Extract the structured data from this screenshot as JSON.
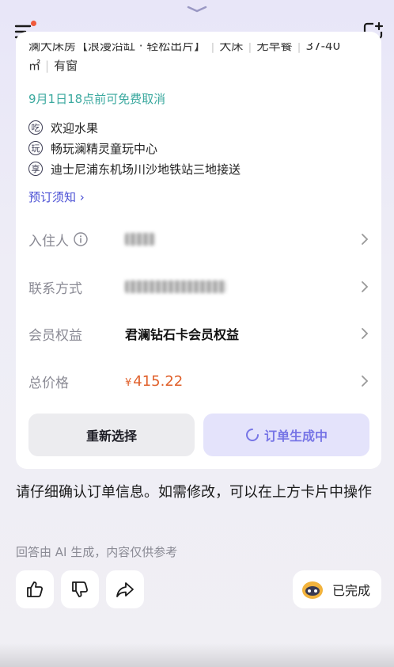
{
  "room": {
    "line1": [
      "澜大床房【浪漫沿缸 · 轻松出片】",
      "大床",
      "无早餐",
      "37-40"
    ],
    "line2_area": "㎡",
    "line2_window": "有窗"
  },
  "cancel_policy": "9月1日18点前可免费取消",
  "perks": [
    {
      "tag": "吃",
      "text": "欢迎水果"
    },
    {
      "tag": "玩",
      "text": "畅玩澜精灵童玩中心"
    },
    {
      "tag": "享",
      "text": "迪士尼浦东机场川沙地铁站三地接送"
    }
  ],
  "booking_notice": "预订须知 ›",
  "fields": {
    "guest_label": "入住人",
    "contact_label": "联系方式",
    "member_label": "会员权益",
    "member_value": "君澜钻石卡会员权益",
    "total_label": "总价格",
    "currency": "¥",
    "total_value": "415.22"
  },
  "buttons": {
    "reselect": "重新选择",
    "generating": "订单生成中"
  },
  "message": "请仔细确认订单信息。如需修改，可以在上方卡片中操作",
  "disclaimer": "回答由 AI 生成，内容仅供参考",
  "status": "已完成",
  "colors": {
    "accent": "#4a4fd4",
    "teal": "#3ba99f",
    "price": "#e0612c",
    "badge": "#f05a3c"
  }
}
